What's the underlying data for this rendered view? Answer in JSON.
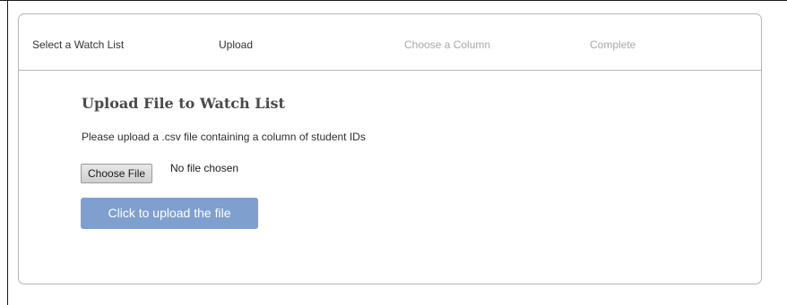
{
  "steps": [
    {
      "label": "Select a Watch List",
      "state": "done"
    },
    {
      "label": "Upload",
      "state": "active"
    },
    {
      "label": "Choose a Column",
      "state": "todo"
    },
    {
      "label": "Complete",
      "state": "todo"
    }
  ],
  "upload": {
    "title": "Upload File to Watch List",
    "description": "Please upload a .csv file containing a column of student IDs",
    "choose_file_label": "Choose File",
    "file_status": "No file chosen",
    "submit_label": "Click to upload the file"
  },
  "colors": {
    "primary_button": "#7f9fcf",
    "inactive_step": "#a8a8a8",
    "active_step": "#333333"
  }
}
